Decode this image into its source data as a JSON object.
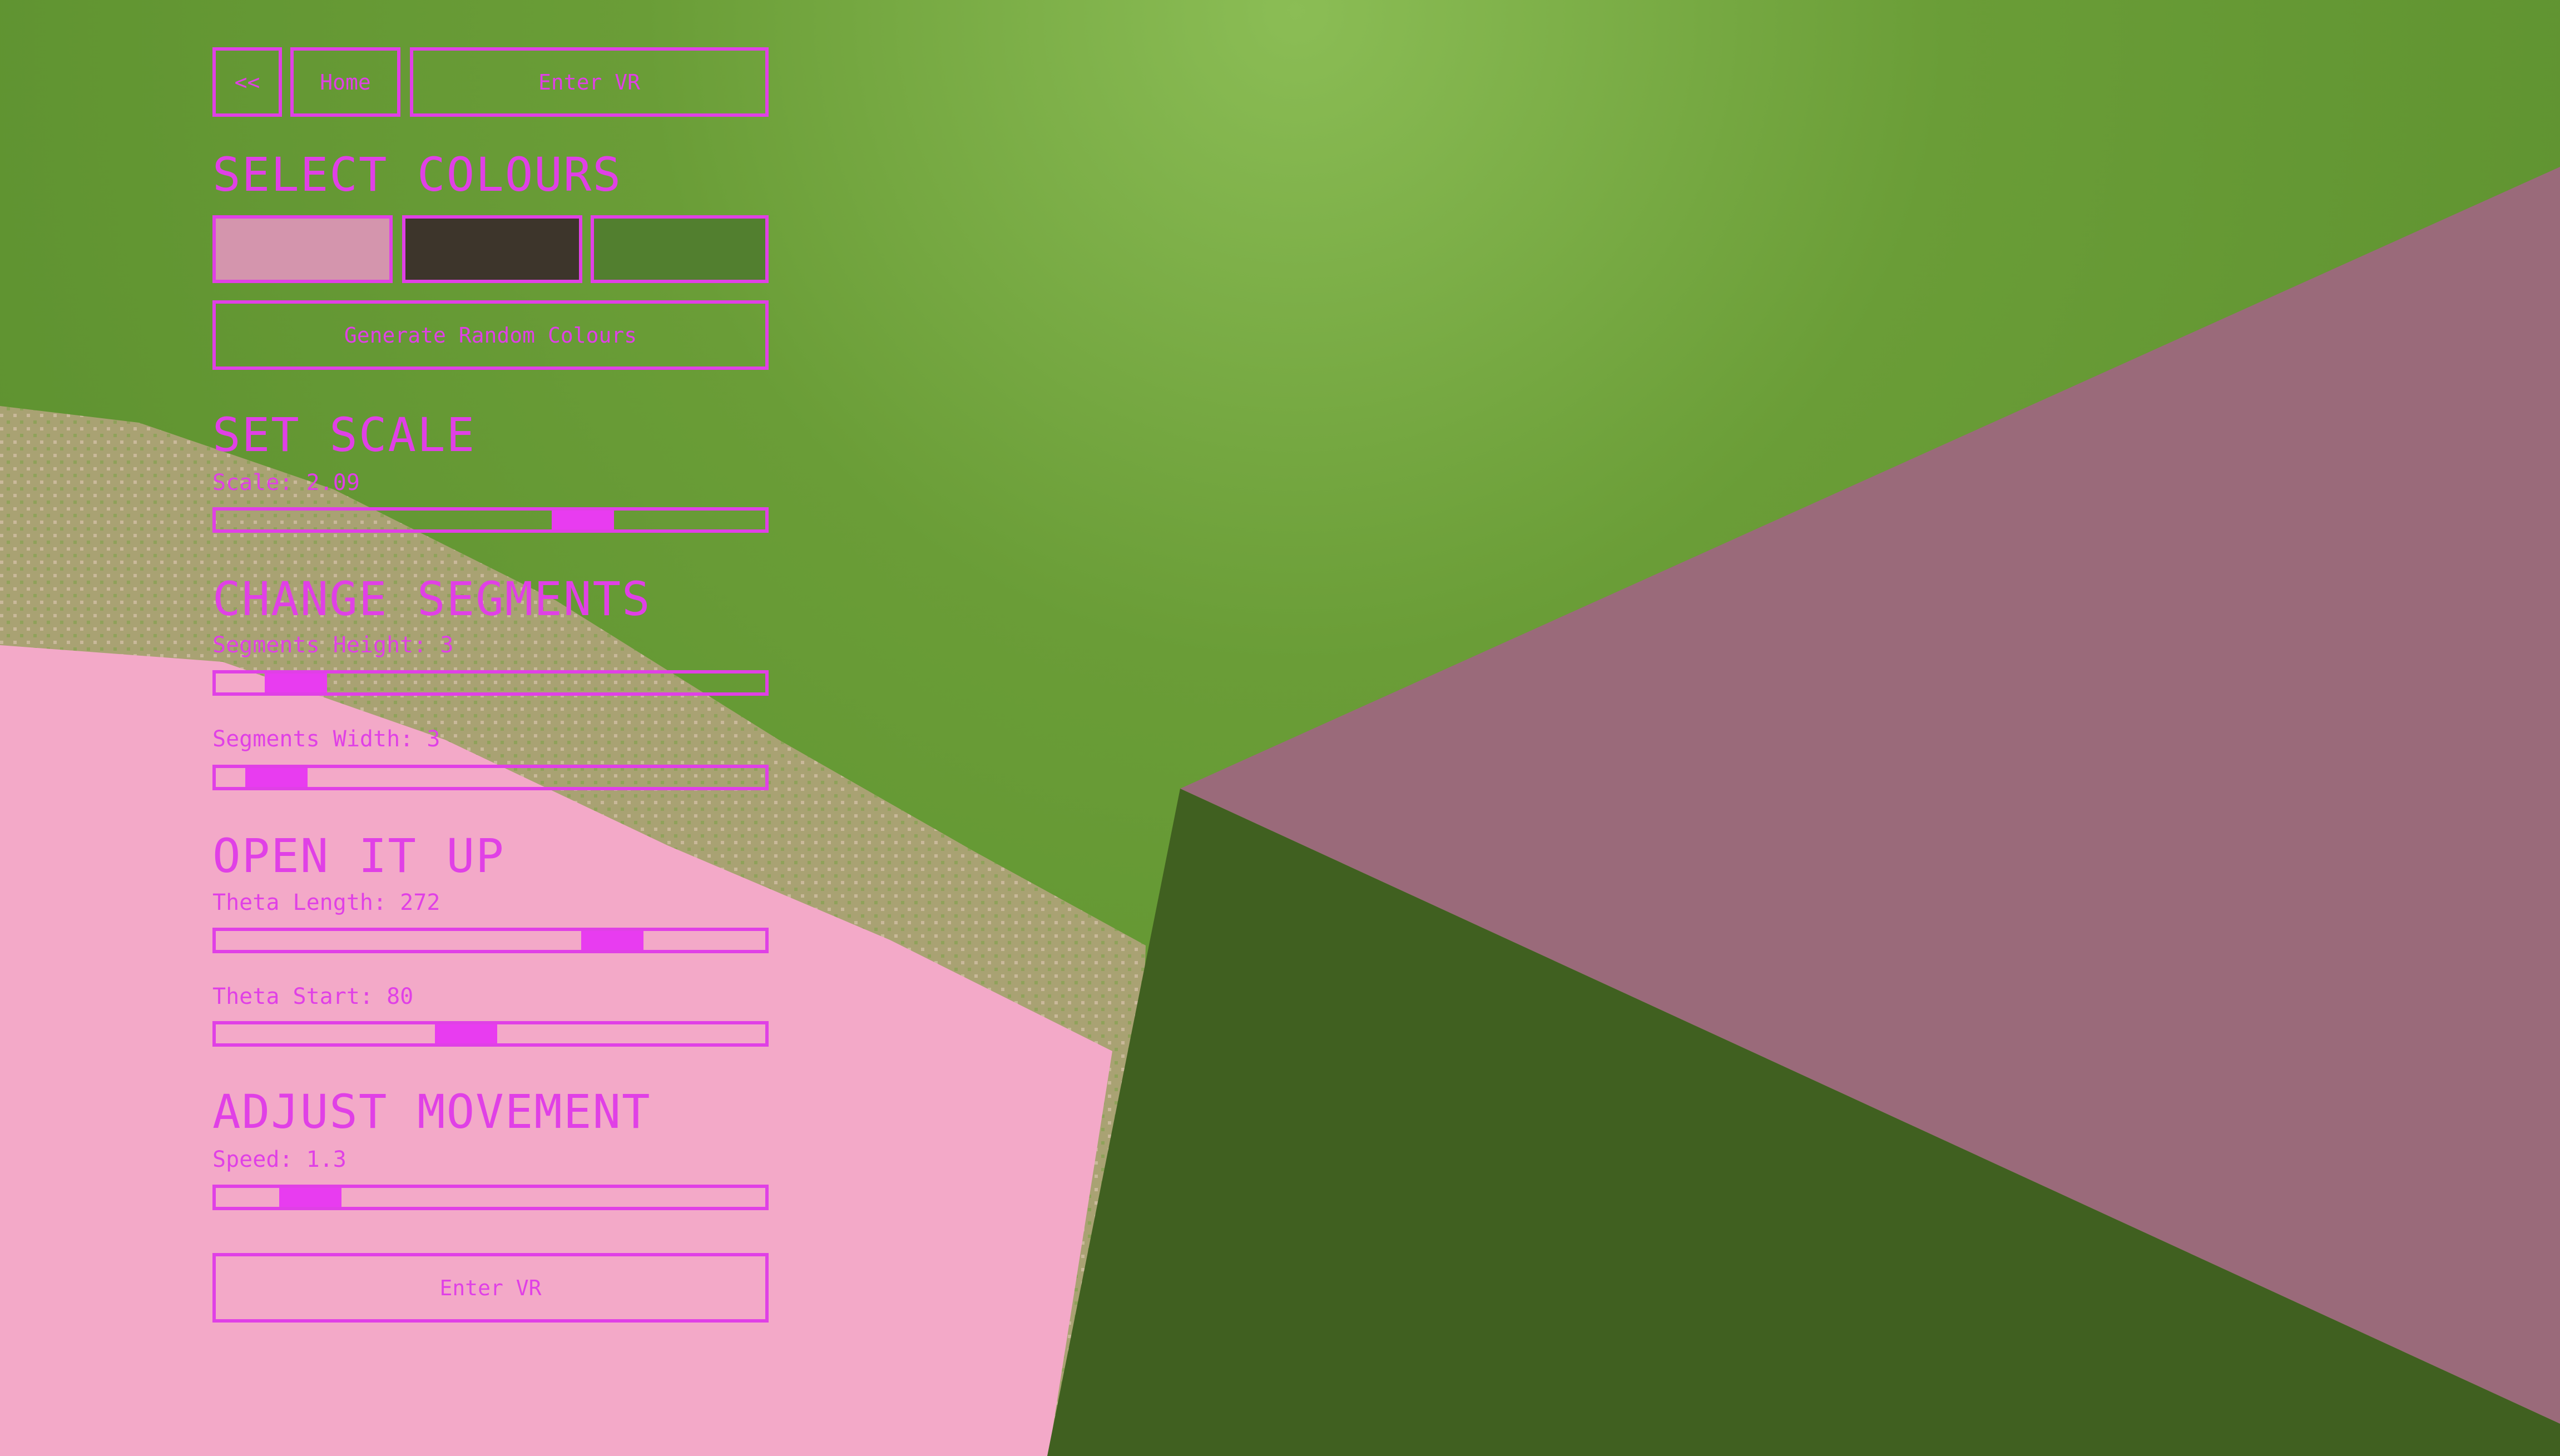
{
  "nav": {
    "back_label": "<<",
    "home_label": "Home",
    "vr_label": "Enter VR"
  },
  "colours": {
    "title": "SELECT COLOURS",
    "swatches": [
      "#d495ad",
      "#3d352b",
      "#527f2f"
    ],
    "random_label": "Generate Random Colours"
  },
  "scale": {
    "title": "SET SCALE",
    "label": "Scale: 2.09",
    "level": 0.69
  },
  "segments": {
    "title": "CHANGE SEGMENTS",
    "height_label": "Segments Height: 3",
    "height_level": 0.1,
    "width_label": "Segments Width: 3",
    "width_level": 0.06
  },
  "open": {
    "title": "OPEN IT UP",
    "theta_length_label": "Theta Length: 272",
    "theta_length_level": 0.75,
    "theta_start_label": "Theta Start: 80",
    "theta_start_level": 0.45
  },
  "movement": {
    "title": "ADJUST MOVEMENT",
    "speed_label": "Speed: 1.3",
    "speed_level": 0.13
  },
  "footer": {
    "vr_label": "Enter VR"
  },
  "scene": {
    "sky_color": "#6a9d37",
    "pink_face_color": "#9a6a7a",
    "dark_face_color": "#406020",
    "ground_color": "#f3a9c8"
  }
}
